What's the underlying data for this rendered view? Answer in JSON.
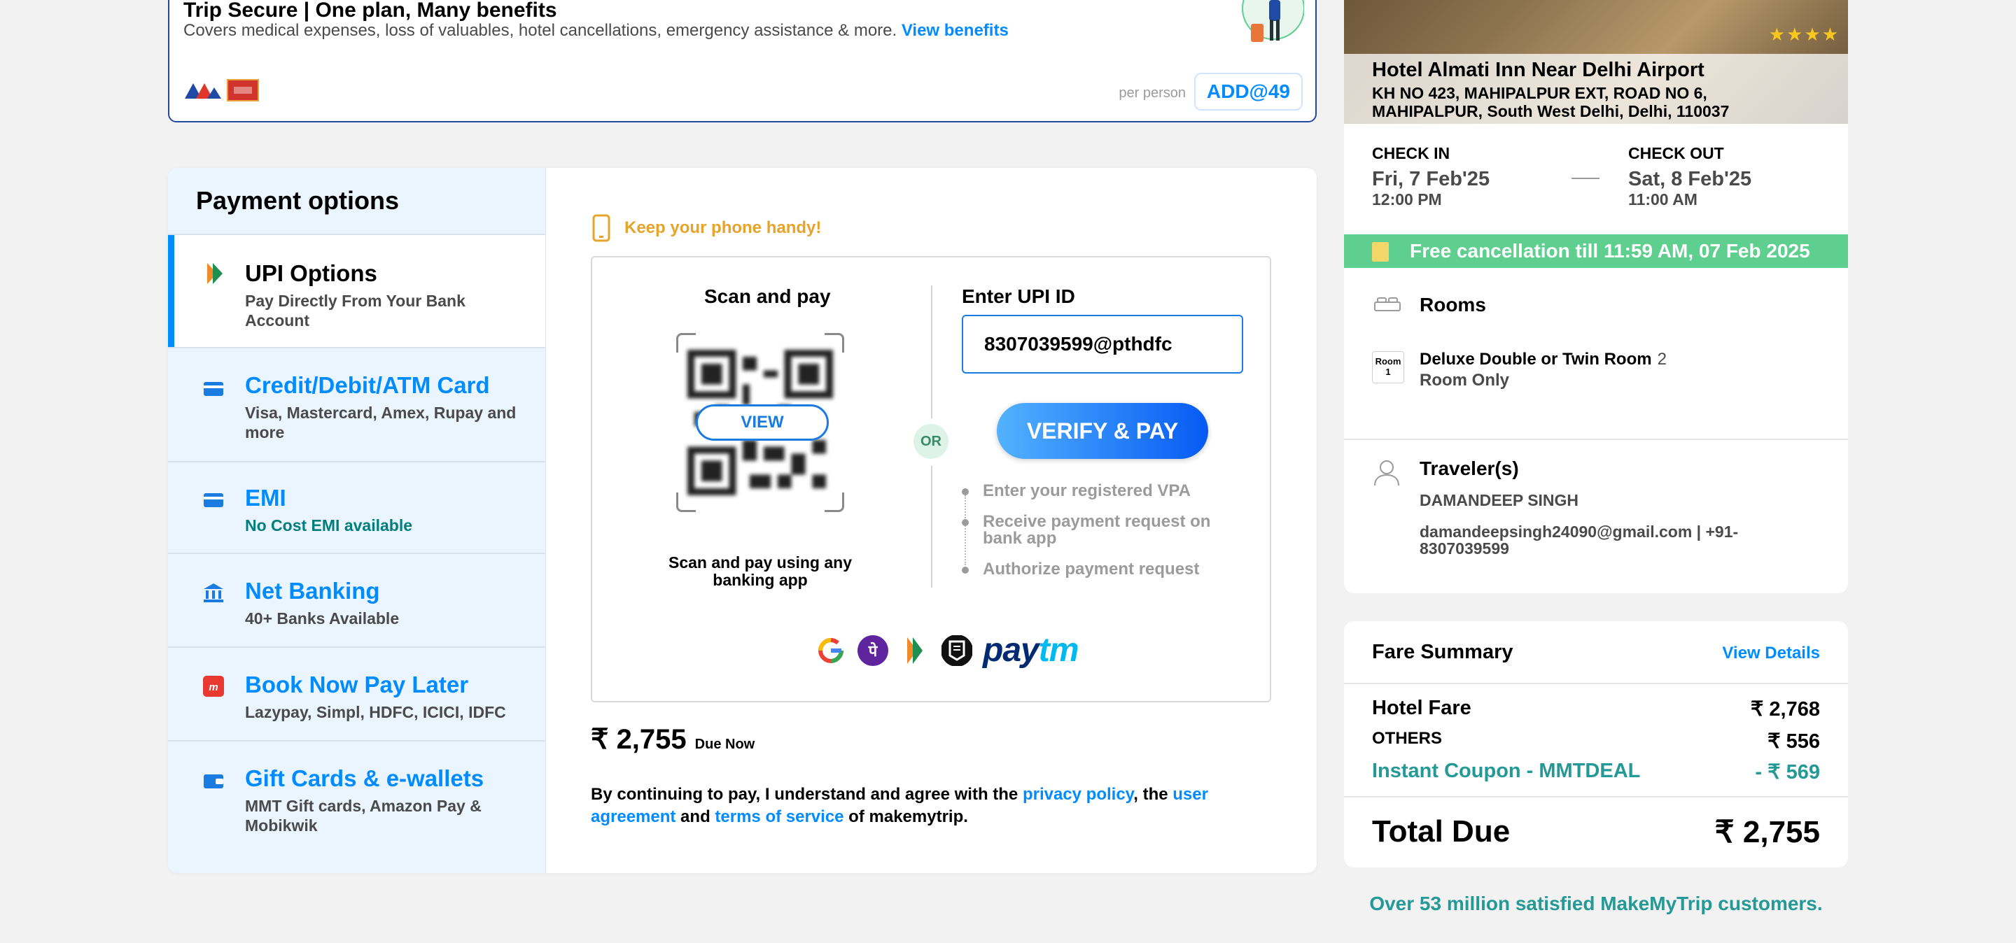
{
  "trip_secure": {
    "title": "Trip Secure | One plan, Many benefits",
    "description": "Covers medical expenses, loss of valuables, hotel cancellations, emergency assistance & more.",
    "view_benefits": "View benefits",
    "per_person": "per person",
    "add_button": "ADD@49"
  },
  "payment": {
    "title": "Payment options",
    "options": [
      {
        "title": "UPI Options",
        "subtitle": "Pay Directly From Your Bank Account",
        "active": true
      },
      {
        "title": "Credit/Debit/ATM Card",
        "subtitle": "Visa, Mastercard, Amex, Rupay and more"
      },
      {
        "title": "EMI",
        "subtitle": "No Cost EMI available"
      },
      {
        "title": "Net Banking",
        "subtitle": "40+ Banks Available"
      },
      {
        "title": "Book Now Pay Later",
        "subtitle": "Lazypay, Simpl, HDFC, ICICI, IDFC"
      },
      {
        "title": "Gift Cards & e-wallets",
        "subtitle": "MMT Gift cards, Amazon Pay & Mobikwik"
      }
    ],
    "keep_phone": "Keep your phone handy!",
    "scan_title": "Scan and pay",
    "view_button": "VIEW",
    "scan_subtitle": "Scan and pay using any banking app",
    "or_label": "OR",
    "upi_label": "Enter UPI ID",
    "upi_value": "8307039599@pthdfc",
    "verify_button": "VERIFY & PAY",
    "steps": [
      "Enter your registered VPA",
      "Receive payment request on bank app",
      "Authorize payment request"
    ],
    "apps": [
      "google-pay-icon",
      "phonepe-icon",
      "bhim-icon",
      "wallet-icon",
      "paytm-logo"
    ],
    "paytm_a": "pay",
    "paytm_b": "tm",
    "due_amount": "₹ 2,755",
    "due_label": "Due Now",
    "agree_1": "By continuing to pay, I understand and agree with the ",
    "privacy_policy": "privacy policy",
    "agree_2": ", the ",
    "user_agreement": "user agreement",
    "agree_3": " and ",
    "terms": "terms of service",
    "agree_4": " of makemytrip."
  },
  "hotel": {
    "name": "Hotel Almati Inn Near Delhi Airport",
    "address": "KH NO 423, MAHIPALPUR EXT, ROAD NO 6, MAHIPALPUR, South West Delhi, Delhi, 110037",
    "stars": "★★★★",
    "check_in_label": "CHECK IN",
    "check_in_date": "Fri, 7 Feb'25",
    "check_in_time": "12:00 PM",
    "check_out_label": "CHECK OUT",
    "check_out_date": "Sat, 8 Feb'25",
    "check_out_time": "11:00 AM",
    "free_cancellation": "Free cancellation till 11:59 AM, 07 Feb 2025",
    "rooms_title": "Rooms",
    "room_badge_1": "Room",
    "room_badge_2": "1",
    "room_name": "Deluxe Double or Twin Room",
    "room_count": "2",
    "room_plan": "Room Only",
    "travelers_title": "Traveler(s)",
    "traveler_name": "DAMANDEEP SINGH",
    "traveler_contact": "damandeepsingh24090@gmail.com | +91-8307039599"
  },
  "fare": {
    "title": "Fare Summary",
    "view_details": "View Details",
    "rows": [
      {
        "label": "Hotel Fare",
        "value": "₹ 2,768"
      },
      {
        "label": "OTHERS",
        "value": "₹ 556"
      },
      {
        "label": "Instant Coupon - MMTDEAL",
        "value": "- ₹ 569"
      }
    ],
    "total_label": "Total Due",
    "total_value": "₹ 2,755"
  },
  "brag": "Over 53 million satisfied MakeMyTrip customers.",
  "colors": {
    "accent": "#008cff",
    "green": "#5fcf8f",
    "teal": "#249995",
    "orange": "#e7a42b"
  }
}
